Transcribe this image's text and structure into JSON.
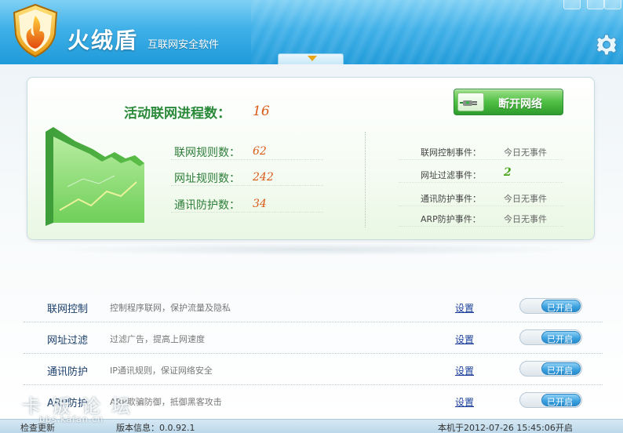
{
  "header": {
    "title": "火绒盾",
    "subtitle": "互联网安全软件"
  },
  "stats": {
    "process_label": "活动联网进程数：",
    "process_value": "16",
    "disconnect_label": "断开网络",
    "rows": [
      {
        "label": "联网规则数：",
        "value": "62"
      },
      {
        "label": "网址规则数：",
        "value": "242"
      },
      {
        "label": "通讯防护数：",
        "value": "34"
      }
    ],
    "events": [
      {
        "label": "联网控制事件：",
        "value": "今日无事件"
      },
      {
        "label": "网址过滤事件：",
        "value": "2"
      },
      {
        "label": "通讯防护事件：",
        "value": "今日无事件"
      },
      {
        "label": "ARP防护事件：",
        "value": "今日无事件"
      }
    ]
  },
  "features": [
    {
      "name": "联网控制",
      "desc": "控制程序联网，保护流量及隐私",
      "setting": "设置",
      "status": "已开启"
    },
    {
      "name": "网址过滤",
      "desc": "过滤广告，提高上网速度",
      "setting": "设置",
      "status": "已开启"
    },
    {
      "name": "通讯防护",
      "desc": "IP通讯规则，保证网络安全",
      "setting": "设置",
      "status": "已开启"
    },
    {
      "name": "ARP防护",
      "desc": "ARP欺骗防御，抵御黑客攻击",
      "setting": "设置",
      "status": "已开启"
    }
  ],
  "statusbar": {
    "check_update": "检查更新",
    "version": "版本信息：0.0.92.1",
    "boot_time": "本机于2012-07-26  15:45:06开启"
  },
  "watermark": {
    "text": "卡饭论坛",
    "url": "bbs.kafan.cn"
  },
  "colors": {
    "header_blue": "#3fb0e8",
    "accent_green": "#2a8a3a",
    "value_orange": "#d95a18",
    "toggle_blue": "#3aa0de"
  },
  "icons": [
    "shield-logo-icon",
    "gear-icon",
    "plug-icon",
    "chevron-down-icon"
  ]
}
